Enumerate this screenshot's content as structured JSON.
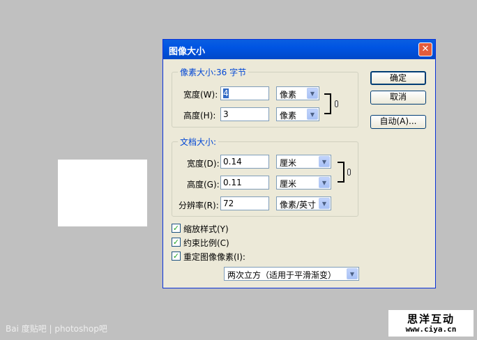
{
  "dialog": {
    "title": "图像大小",
    "close_glyph": "✕",
    "pixel_group": {
      "title": "像素大小:36 字节",
      "width_label": "宽度(W):",
      "width_value": "4",
      "width_unit": "像素",
      "height_label": "高度(H):",
      "height_value": "3",
      "height_unit": "像素"
    },
    "doc_group": {
      "title": "文档大小:",
      "width_label": "宽度(D):",
      "width_value": "0.14",
      "width_unit": "厘米",
      "height_label": "高度(G):",
      "height_value": "0.11",
      "height_unit": "厘米",
      "resolution_label": "分辨率(R):",
      "resolution_value": "72",
      "resolution_unit": "像素/英寸"
    },
    "buttons": {
      "ok": "确定",
      "cancel": "取消",
      "auto": "自动(A)..."
    },
    "options": {
      "scale_styles": {
        "label": "缩放样式(Y)",
        "checked": true
      },
      "constrain": {
        "label": "约束比例(C)",
        "checked": true
      },
      "resample": {
        "label": "重定图像像素(I):",
        "checked": true
      }
    },
    "resample_method": "两次立方（适用于平滑渐变）"
  },
  "icons": {
    "dropdown_arrow": "chevron-down-icon",
    "check": "checkmark-icon",
    "link": "chain-link-icon"
  },
  "check_glyph": "✓",
  "arrow_glyph": "▼",
  "watermark": "Bai 度贴吧 | photoshop吧",
  "site_logo": {
    "line1": "思洋互动",
    "line2": "www.ciya.cn"
  },
  "colors": {
    "titlebar": "#0054e3",
    "legend": "#0046d5",
    "dialog_bg": "#ece9d8",
    "workspace": "#c0c0c0"
  }
}
